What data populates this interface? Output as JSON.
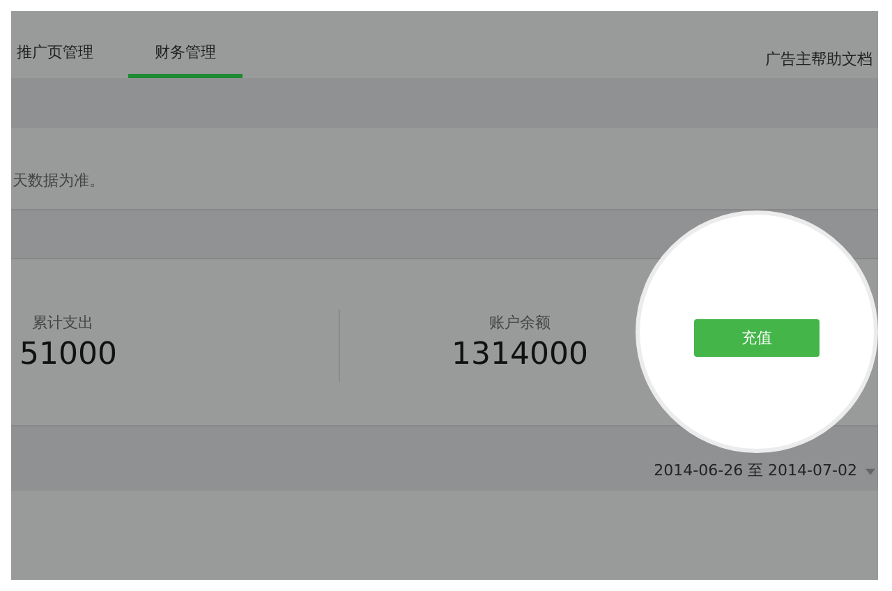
{
  "tabs": [
    {
      "label": "推广页管理",
      "selected": false
    },
    {
      "label": "财务管理",
      "selected": true
    }
  ],
  "help_link": "广告主帮助文档",
  "notice": "天数据为准。",
  "stats": [
    {
      "label": "累计支出",
      "value": "51000"
    },
    {
      "label": "账户余额",
      "value": "1314000"
    }
  ],
  "recharge_button": "充值",
  "date_range": "2014-06-26 至 2014-07-02"
}
